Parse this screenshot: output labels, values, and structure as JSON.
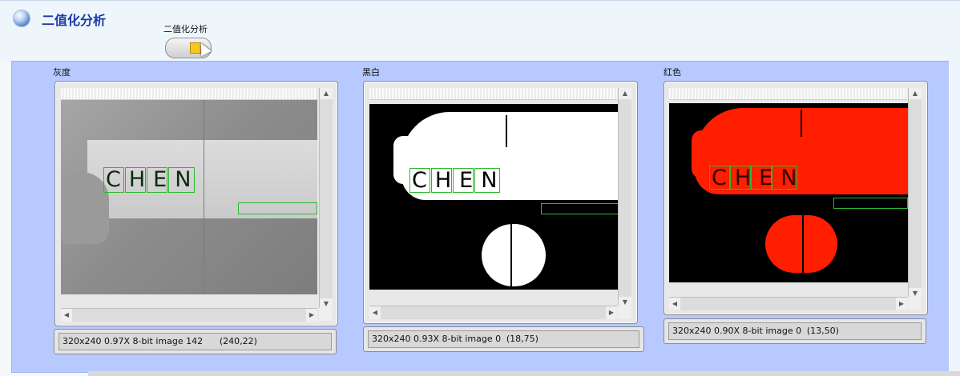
{
  "header": {
    "title": "二值化分析",
    "tool_label": "二值化分析",
    "icons": {
      "app": "globe-icon",
      "tool": "folder-icon",
      "pointer": "cursor-icon"
    }
  },
  "views": [
    {
      "label": "灰度",
      "image_text": "CHEN",
      "status": "320x240 0.97X 8-bit image 142\t(240,22)"
    },
    {
      "label": "黑白",
      "image_text": "CHEN",
      "status": "320x240 0.93X 8-bit image 0\t(18,75)"
    },
    {
      "label": "红色",
      "image_text": "CHEN",
      "status": "320x240 0.90X 8-bit image 0\t(13,50)"
    }
  ],
  "colors": {
    "panel": "#b7c9ff",
    "title": "#1a3aa8",
    "overlay_box": "#2fb82f",
    "red_channel": "#ff1e00",
    "tool_icon": "#f6c623"
  }
}
